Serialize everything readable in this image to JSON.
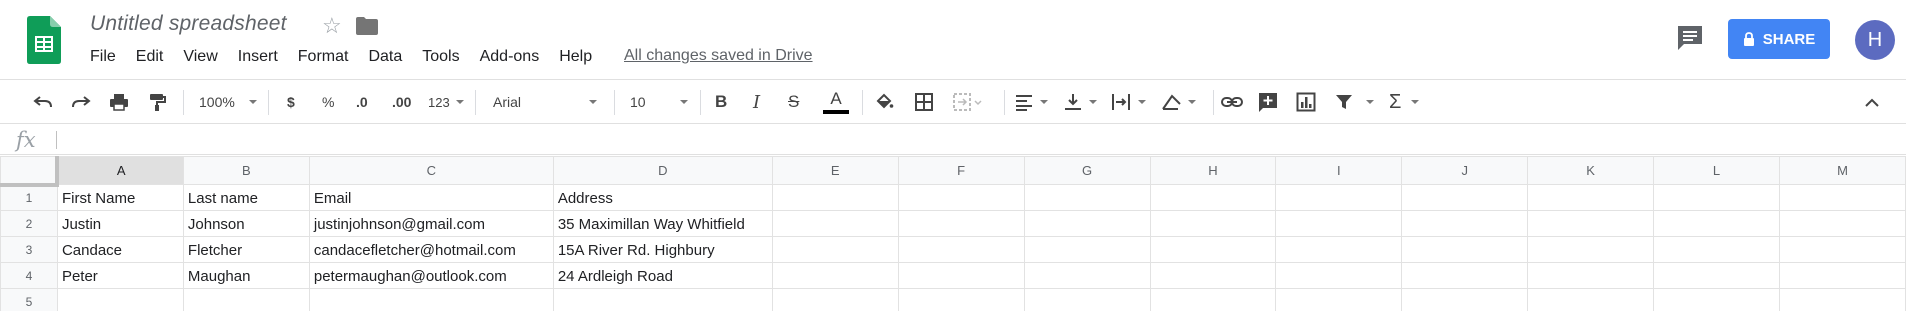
{
  "app": {
    "title": "Untitled spreadsheet",
    "saved_status": "All changes saved in Drive",
    "share_label": "SHARE",
    "avatar_initial": "H",
    "brand_color": "#0f9d58",
    "share_color": "#4285f4"
  },
  "menu": [
    "File",
    "Edit",
    "View",
    "Insert",
    "Format",
    "Data",
    "Tools",
    "Add-ons",
    "Help"
  ],
  "toolbar": {
    "zoom": "100%",
    "currency": "$",
    "percent": "%",
    "decrease_decimal": ".0",
    "increase_decimal": ".00",
    "more_formats": "123",
    "font": "Arial",
    "font_size": "10",
    "icons": [
      "undo-icon",
      "redo-icon",
      "print-icon",
      "paint-format-icon",
      "bold-icon",
      "italic-icon",
      "strikethrough-icon",
      "text-color-icon",
      "fill-color-icon",
      "borders-icon",
      "merge-cells-icon",
      "align-left-icon",
      "vertical-align-icon",
      "text-wrap-icon",
      "text-rotation-icon",
      "link-icon",
      "comment-add-icon",
      "chart-icon",
      "filter-icon",
      "functions-icon",
      "collapse-icon"
    ]
  },
  "formula_bar": {
    "fx_label": "fx",
    "value": ""
  },
  "sheet": {
    "columns": [
      "A",
      "B",
      "C",
      "D",
      "E",
      "F",
      "G",
      "H",
      "I",
      "J",
      "K",
      "L",
      "M"
    ],
    "rows": [
      {
        "num": "1",
        "cells": [
          "First Name",
          "Last name",
          "Email",
          "Address",
          "",
          "",
          "",
          "",
          "",
          "",
          "",
          "",
          ""
        ]
      },
      {
        "num": "2",
        "cells": [
          "Justin",
          "Johnson",
          "justinjohnson@gmail.com",
          "35 Maximillan Way Whitfield",
          "",
          "",
          "",
          "",
          "",
          "",
          "",
          "",
          ""
        ]
      },
      {
        "num": "3",
        "cells": [
          "Candace",
          "Fletcher",
          "candacefletcher@hotmail.com",
          "15A River Rd. Highbury",
          "",
          "",
          "",
          "",
          "",
          "",
          "",
          "",
          ""
        ]
      },
      {
        "num": "4",
        "cells": [
          "Peter",
          "Maughan",
          "petermaughan@outlook.com",
          "24 Ardleigh Road",
          "",
          "",
          "",
          "",
          "",
          "",
          "",
          "",
          ""
        ]
      },
      {
        "num": "5",
        "cells": [
          "",
          "",
          "",
          "",
          "",
          "",
          "",
          "",
          "",
          "",
          "",
          "",
          ""
        ]
      }
    ]
  }
}
